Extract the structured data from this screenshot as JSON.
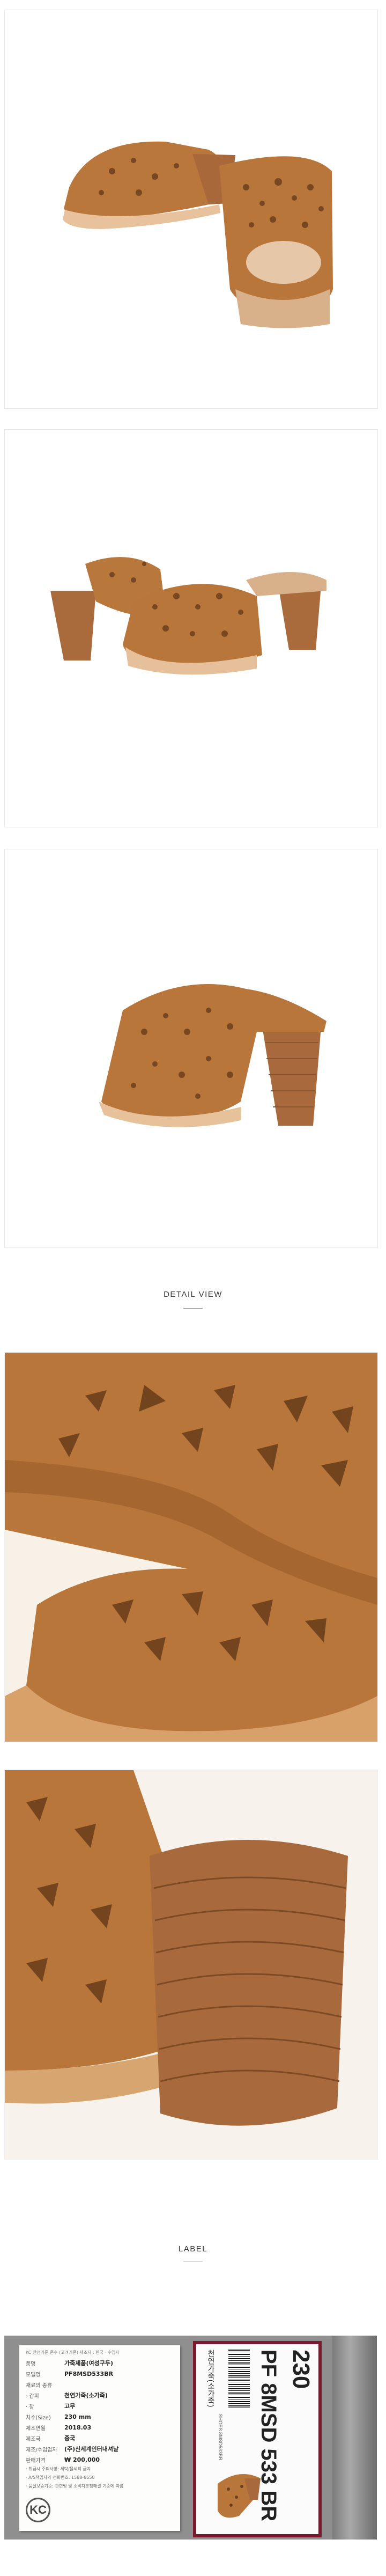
{
  "sections": {
    "detail_view": "DETAIL VIEW",
    "label": "LABEL"
  },
  "label_card": {
    "header": "KC 안전기준 준수 (고려기준) 제조자 : 한국 · 수입자",
    "rows": [
      {
        "key": "품명",
        "value": "가죽제품(여성구두)"
      },
      {
        "key": "모델명",
        "value": "PF8MSD533BR"
      },
      {
        "key": "재료의 종류",
        "value": ""
      },
      {
        "key": "· 갑피",
        "value": "천연가죽(소가죽)"
      },
      {
        "key": "· 창",
        "value": "고무"
      },
      {
        "key": "치수(Size)",
        "value": "230 mm"
      },
      {
        "key": "제조연월",
        "value": "2018.03"
      },
      {
        "key": "제조국",
        "value": "중국"
      },
      {
        "key": "제조/수입업자",
        "value": "(주)신세계인터내셔날"
      },
      {
        "key": "판매가격",
        "value": "₩ 200,000"
      }
    ],
    "notes": [
      "· 취급시 주의사항: 세탁/물세척 금지",
      "· A/S책임자와 전화번호: 1588-8558",
      "· 품질보증기준: 관련법 및 소비자분쟁해결 기준에 따름"
    ],
    "kc_mark": "KC"
  },
  "size_tag": {
    "size": "230",
    "model": "PF 8MSD 533 BR",
    "material": "천연가죽(소가죽)",
    "small_code": "SHOES 8MSD533BR"
  },
  "colors": {
    "leather": "#b8763a",
    "heel": "#a86a3b",
    "tag_border": "#7a1a2e"
  }
}
